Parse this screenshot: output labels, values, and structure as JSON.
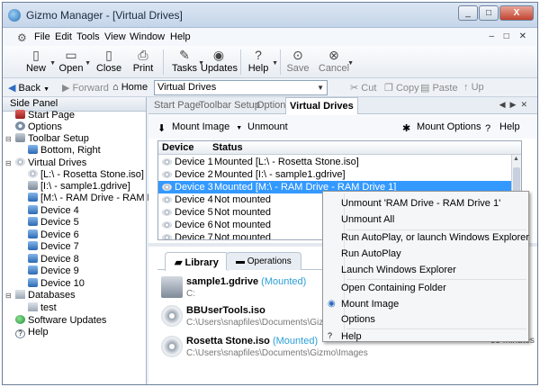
{
  "window": {
    "title": "Gizmo Manager - [Virtual Drives]",
    "controls": [
      "_",
      "□",
      "X"
    ],
    "mdi_controls": "– □ ✕"
  },
  "menubar": {
    "items": [
      "File",
      "Edit",
      "Tools",
      "View",
      "Window",
      "Help"
    ]
  },
  "toolbar": {
    "new": "New",
    "open": "Open",
    "close": "Close",
    "print": "Print",
    "tasks": "Tasks",
    "updates": "Updates",
    "help": "Help",
    "save": "Save",
    "cancel": "Cancel"
  },
  "navbar": {
    "back": "Back",
    "forward": "Forward",
    "home": "Home",
    "address": "Virtual Drives",
    "cut": "Cut",
    "copy": "Copy",
    "paste": "Paste",
    "up": "Up"
  },
  "side_panel": {
    "title": "Side Panel",
    "items": [
      {
        "label": "Start Page"
      },
      {
        "label": "Options"
      },
      {
        "label": "Toolbar Setup"
      },
      {
        "label": "Bottom, Right"
      },
      {
        "label": "Virtual Drives"
      },
      {
        "label": "[L:\\ - Rosetta Stone.iso]"
      },
      {
        "label": "[I:\\ - sample1.gdrive]"
      },
      {
        "label": "[M:\\ - RAM Drive - RAM D"
      },
      {
        "label": "Device 4"
      },
      {
        "label": "Device 5"
      },
      {
        "label": "Device 6"
      },
      {
        "label": "Device 7"
      },
      {
        "label": "Device 8"
      },
      {
        "label": "Device 9"
      },
      {
        "label": "Device 10"
      },
      {
        "label": "Databases"
      },
      {
        "label": "test"
      },
      {
        "label": "Software Updates"
      },
      {
        "label": "Help"
      }
    ]
  },
  "content_tabs": [
    "Start Page",
    "Toolbar Setup",
    "Options",
    "Virtual Drives"
  ],
  "vd_toolbar": {
    "mount_image": "Mount Image",
    "unmount": "Unmount",
    "mount_options": "Mount Options",
    "help": "Help"
  },
  "device_table": {
    "columns": [
      "Device",
      "Status"
    ],
    "rows": [
      {
        "device": "Device 1",
        "status": "Mounted [L:\\ - Rosetta Stone.iso]"
      },
      {
        "device": "Device 2",
        "status": "Mounted [I:\\ - sample1.gdrive]"
      },
      {
        "device": "Device 3",
        "status": "Mounted [M:\\ - RAM Drive - RAM Drive 1]"
      },
      {
        "device": "Device 4",
        "status": "Not mounted"
      },
      {
        "device": "Device 5",
        "status": "Not mounted"
      },
      {
        "device": "Device 6",
        "status": "Not mounted"
      },
      {
        "device": "Device 7",
        "status": "Not mounted"
      }
    ]
  },
  "library_tabs": [
    "Library",
    "Operations"
  ],
  "library": [
    {
      "name": "sample1.gdrive",
      "status": "(Mounted)",
      "path": "C:",
      "time": ""
    },
    {
      "name": "BBUserTools.iso",
      "status": "",
      "path": "C:\\Users\\snapfiles\\Documents\\Gizmo\\",
      "time": ""
    },
    {
      "name": "Rosetta Stone.iso",
      "status": "(Mounted)",
      "path": "C:\\Users\\snapfiles\\Documents\\Gizmo\\Images",
      "time": "55 minutes ago"
    }
  ],
  "context_menu": {
    "unmount_ram": "Unmount 'RAM Drive - RAM Drive 1'",
    "unmount_all": "Unmount All",
    "run_autoplay_or_explorer": "Run AutoPlay, or launch Windows Explorer",
    "run_autoplay": "Run AutoPlay",
    "launch_explorer": "Launch Windows Explorer",
    "open_folder": "Open Containing Folder",
    "mount_image": "Mount Image",
    "options": "Options",
    "help": "Help"
  }
}
